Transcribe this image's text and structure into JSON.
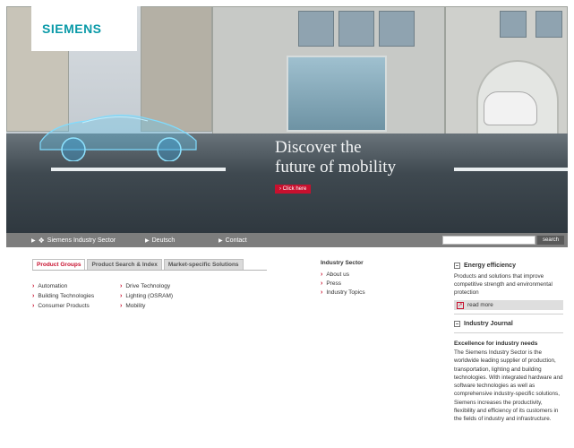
{
  "brand": {
    "logo": "SIEMENS",
    "accent": "#0a9aa8",
    "red": "#c8102e"
  },
  "hero": {
    "headline_line1": "Discover the",
    "headline_line2": "future of mobility",
    "cta_label": "› Click here"
  },
  "nav": {
    "items": [
      {
        "label": "Siemens Industry Sector"
      },
      {
        "label": "Deutsch"
      },
      {
        "label": "Contact"
      }
    ],
    "search_placeholder": "",
    "search_button": "search"
  },
  "tabs": [
    {
      "label": "Product Groups",
      "active": true
    },
    {
      "label": "Product Search & Index",
      "active": false
    },
    {
      "label": "Market-specific Solutions",
      "active": false
    }
  ],
  "product_groups": {
    "col1": [
      "Automation",
      "Building Technologies",
      "Consumer Products"
    ],
    "col2": [
      "Drive Technology",
      "Lighting (OSRAM)",
      "Mobility"
    ]
  },
  "industry_sector": {
    "title": "Industry Sector",
    "links": [
      "About us",
      "Press",
      "Industry Topics"
    ]
  },
  "right": {
    "energy_title": "Energy efficiency",
    "energy_text": "Products and solutions that improve competitive strength and environmental protection",
    "read_more": "read more",
    "journal_title": "Industry Journal",
    "excellence_title": "Excellence for industry needs",
    "excellence_text": "The Siemens Industry Sector is the worldwide leading supplier of production, transportation, lighting and building technologies. With integrated hardware and software technologies as well as comprehensive industry-specific solutions, Siemens increases the productivity, flexibility and efficiency of its customers in the fields of industry and infrastructure."
  }
}
